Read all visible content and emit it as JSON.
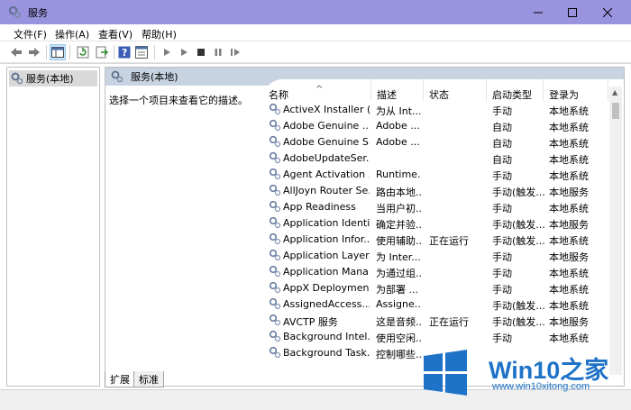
{
  "window": {
    "title": "服务",
    "controls": {
      "minimize": "minimize-icon",
      "maximize": "maximize-icon",
      "close": "close-icon"
    }
  },
  "menu": [
    "文件(F)",
    "操作(A)",
    "查看(V)",
    "帮助(H)"
  ],
  "toolbar": {
    "icons": [
      "back-arrow-icon",
      "forward-arrow-icon",
      "console-tree-icon",
      "refresh-icon",
      "export-list-icon",
      "help-icon",
      "properties-icon",
      "start-icon",
      "start-alt-icon",
      "stop-icon",
      "pause-icon",
      "restart-icon"
    ]
  },
  "tree": {
    "root_label": "服务(本地)"
  },
  "panel": {
    "header": "服务(本地)",
    "description": "选择一个项目来查看它的描述。"
  },
  "list": {
    "columns": [
      "名称",
      "描述",
      "状态",
      "启动类型",
      "登录为"
    ],
    "sorted_column": "名称",
    "rows": [
      {
        "name": "ActiveX Installer (...",
        "desc": "为从 Int...",
        "status": "",
        "start": "手动",
        "logon": "本地系统"
      },
      {
        "name": "Adobe Genuine ...",
        "desc": "Adobe ...",
        "status": "",
        "start": "自动",
        "logon": "本地系统"
      },
      {
        "name": "Adobe Genuine S...",
        "desc": "Adobe ...",
        "status": "",
        "start": "自动",
        "logon": "本地系统"
      },
      {
        "name": "AdobeUpdateSer...",
        "desc": "",
        "status": "",
        "start": "自动",
        "logon": "本地系统"
      },
      {
        "name": "Agent Activation ...",
        "desc": "Runtime...",
        "status": "",
        "start": "手动",
        "logon": "本地系统"
      },
      {
        "name": "AllJoyn Router Se...",
        "desc": "路由本地...",
        "status": "",
        "start": "手动(触发...",
        "logon": "本地服务"
      },
      {
        "name": "App Readiness",
        "desc": "当用户初...",
        "status": "",
        "start": "手动",
        "logon": "本地系统"
      },
      {
        "name": "Application Identi...",
        "desc": "确定并验...",
        "status": "",
        "start": "手动(触发...",
        "logon": "本地服务"
      },
      {
        "name": "Application Infor...",
        "desc": "使用辅助...",
        "status": "正在运行",
        "start": "手动(触发...",
        "logon": "本地系统"
      },
      {
        "name": "Application Layer...",
        "desc": "为 Inter...",
        "status": "",
        "start": "手动",
        "logon": "本地服务"
      },
      {
        "name": "Application Mana...",
        "desc": "为通过组...",
        "status": "",
        "start": "手动",
        "logon": "本地系统"
      },
      {
        "name": "AppX Deploymen...",
        "desc": "为部署 ...",
        "status": "",
        "start": "手动",
        "logon": "本地系统"
      },
      {
        "name": "AssignedAccess...",
        "desc": "Assigne...",
        "status": "",
        "start": "手动(触发...",
        "logon": "本地系统"
      },
      {
        "name": "AVCTP 服务",
        "desc": "这是音频...",
        "status": "正在运行",
        "start": "手动(触发...",
        "logon": "本地服务"
      },
      {
        "name": "Background Intel...",
        "desc": "使用空闲...",
        "status": "",
        "start": "手动",
        "logon": "本地系统"
      },
      {
        "name": "Background Task...",
        "desc": "控制哪些...",
        "status": "",
        "start": "",
        "logon": ""
      }
    ]
  },
  "tabs": [
    "扩展",
    "标准"
  ],
  "active_tab": "扩展",
  "watermark": {
    "brand": "Win10之家",
    "url": "www.win10xitong.com"
  }
}
